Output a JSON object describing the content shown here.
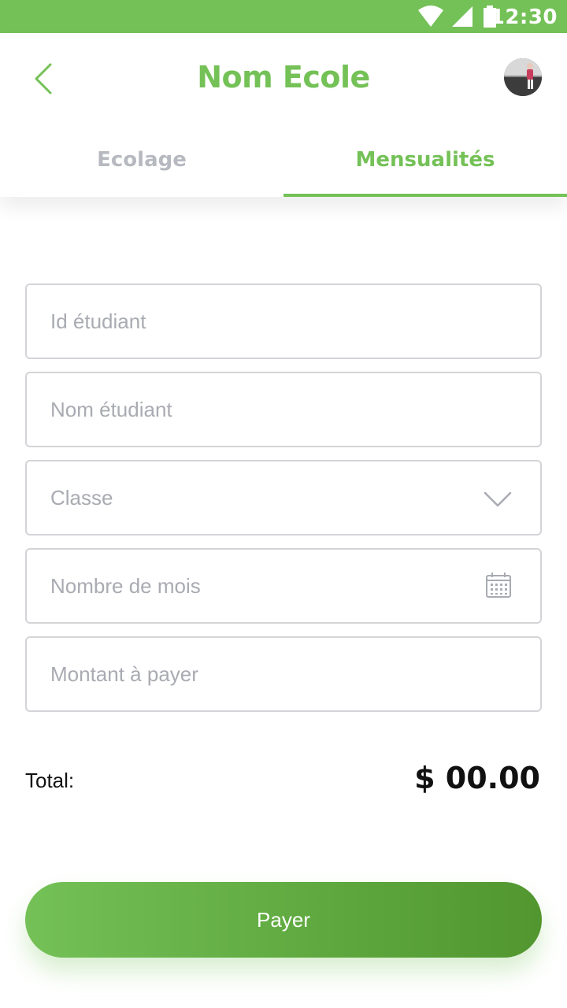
{
  "status_bar": {
    "time": "12:30",
    "bg_color": "#74c157"
  },
  "header": {
    "title": "Nom Ecole",
    "back_icon": "chevron-left-icon",
    "avatar": "user-avatar"
  },
  "tabs": [
    {
      "label": "Ecolage",
      "active": false
    },
    {
      "label": "Mensualités",
      "active": true
    }
  ],
  "form": {
    "id_etudiant": {
      "placeholder": "Id étudiant",
      "value": ""
    },
    "nom_etudiant": {
      "placeholder": "Nom étudiant",
      "value": ""
    },
    "classe": {
      "placeholder": "Classe",
      "value": "",
      "icon": "chevron-down-icon"
    },
    "nombre_mois": {
      "placeholder": "Nombre de mois",
      "value": "",
      "icon": "calendar-icon"
    },
    "montant": {
      "placeholder": "Montant à payer",
      "value": ""
    }
  },
  "summary": {
    "total_label": "Total:",
    "total_value": "$ 00.00"
  },
  "actions": {
    "pay_label": "Payer"
  },
  "colors": {
    "accent": "#74c157",
    "accent_dark": "#52962f",
    "placeholder": "#a9abb2",
    "border": "#d4d4d8"
  }
}
